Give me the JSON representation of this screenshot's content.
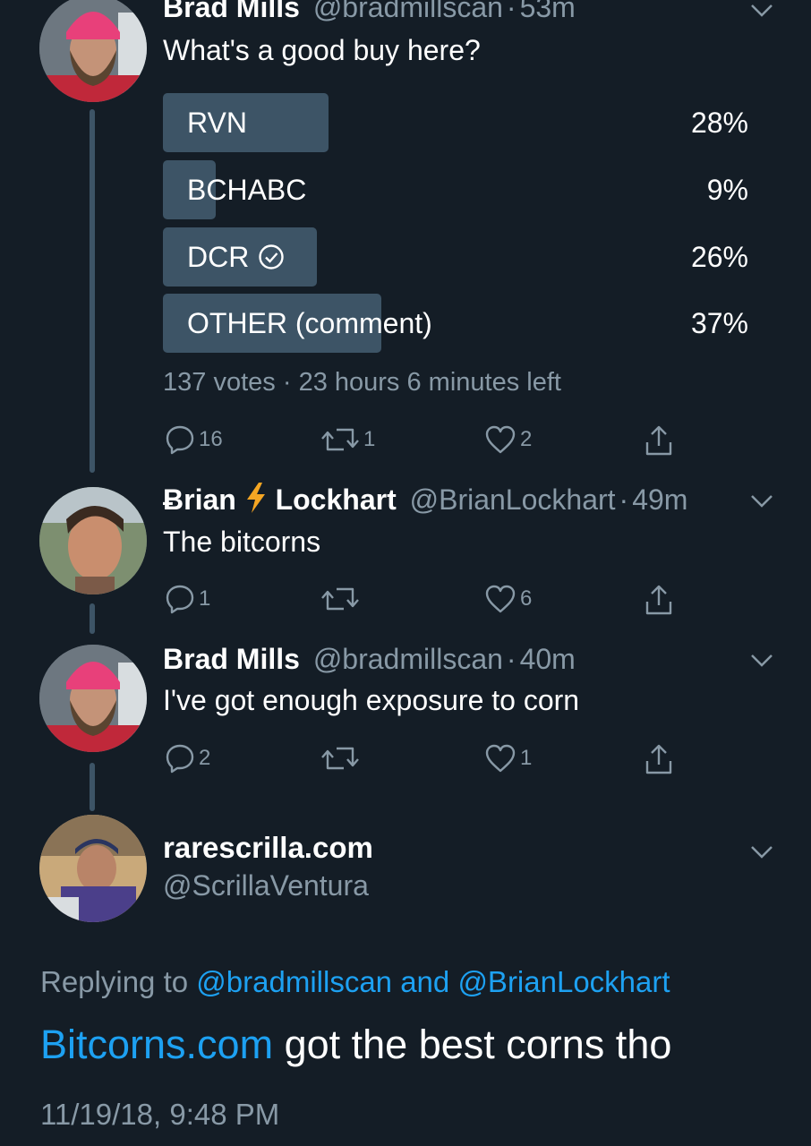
{
  "tweet1": {
    "name": "Brad Mills",
    "handle": "@bradmillscan",
    "time": "53m",
    "text": "What's a good buy here?",
    "poll": {
      "options": [
        {
          "label": "RVN",
          "percent": "28%",
          "fraction": 0.28,
          "selected": false
        },
        {
          "label": "BCHABC",
          "percent": "9%",
          "fraction": 0.09,
          "selected": false
        },
        {
          "label": "DCR",
          "percent": "26%",
          "fraction": 0.26,
          "selected": true
        },
        {
          "label": "OTHER (comment)",
          "percent": "37%",
          "fraction": 0.37,
          "selected": false
        }
      ],
      "votes": "137 votes",
      "time_left": "23 hours 6 minutes left"
    },
    "actions": {
      "replies": "16",
      "retweets": "1",
      "likes": "2"
    }
  },
  "tweet2": {
    "name_part1": "Ƀrian",
    "name_emoji": "⚡",
    "name_part2": "Lockhart",
    "handle": "@BrianLockhart",
    "time": "49m",
    "text": "The bitcorns",
    "actions": {
      "replies": "1",
      "retweets": "",
      "likes": "6"
    }
  },
  "tweet3": {
    "name": "Brad Mills",
    "handle": "@bradmillscan",
    "time": "40m",
    "text": "I've got enough exposure to corn",
    "actions": {
      "replies": "2",
      "retweets": "",
      "likes": "1"
    }
  },
  "detail": {
    "name": "rarescrilla.com",
    "handle": "@ScrillaVentura",
    "replying_prefix": "Replying to",
    "replying_user1": "@bradmillscan",
    "replying_and": "and",
    "replying_user2": "@BrianLockhart",
    "text_link": "Bitcorns.com",
    "text_rest": "got the best corns tho",
    "timestamp": "11/19/18, 9:48 PM"
  },
  "separator": "·",
  "colors": {
    "background": "#141d26",
    "poll_bar": "#3d5466",
    "muted": "#8899a6",
    "link": "#1da1f2",
    "lightning": "#f5a623"
  },
  "icons": [
    "reply-icon",
    "retweet-icon",
    "like-icon",
    "share-icon",
    "chevron-down-icon",
    "check-circle-icon"
  ]
}
